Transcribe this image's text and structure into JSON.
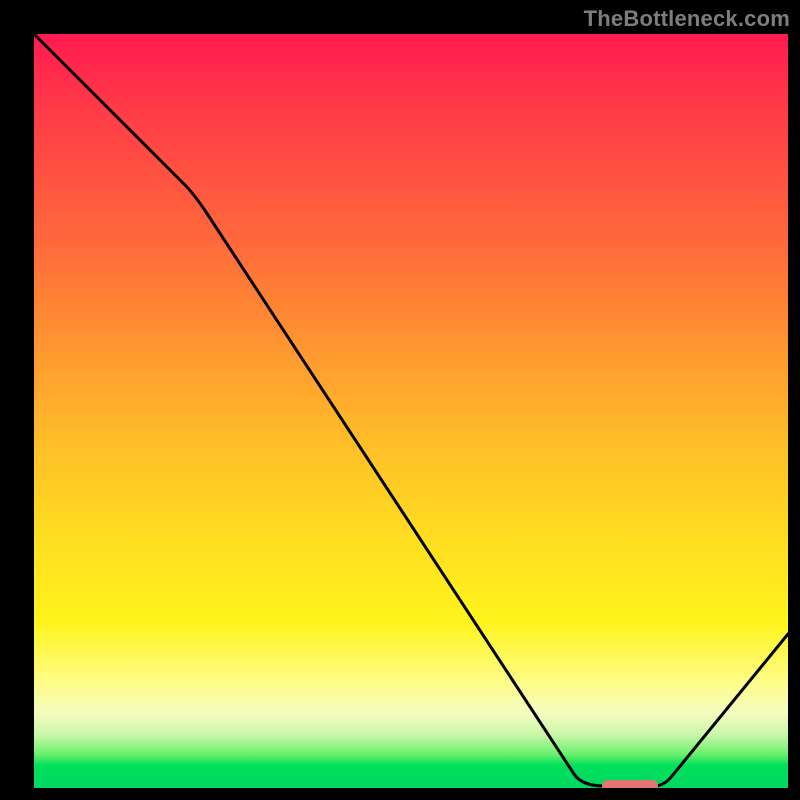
{
  "watermark": "TheBottleneck.com",
  "chart_data": {
    "type": "line",
    "title": "",
    "xlabel": "",
    "ylabel": "",
    "xlim": [
      0,
      100
    ],
    "ylim": [
      0,
      100
    ],
    "x": [
      0,
      20,
      72,
      76,
      82,
      100
    ],
    "values": [
      100,
      80,
      2,
      0,
      0,
      20
    ],
    "marker": {
      "x_start": 76,
      "x_end": 82,
      "y": 0
    },
    "background_gradient_top_to_bottom": [
      "#ff1a50",
      "#ffe020",
      "#00d862"
    ]
  }
}
